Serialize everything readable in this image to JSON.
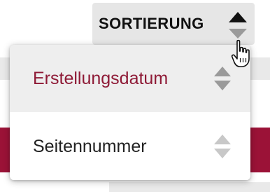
{
  "sort": {
    "button_label": "SORTIERUNG",
    "icon": "sort-arrows-icon"
  },
  "dropdown": {
    "options": [
      {
        "label": "Erstellungsdatum",
        "selected": true,
        "icon": "sort-arrows-icon"
      },
      {
        "label": "Seitennummer",
        "selected": false,
        "icon": "sort-arrows-icon"
      }
    ]
  },
  "cursor": {
    "icon": "hand-pointer-icon"
  },
  "colors": {
    "accent": "#9b1237",
    "selected_text": "#8e1a36",
    "button_bg": "#e6e6e6",
    "selected_bg": "#eeeeee"
  }
}
